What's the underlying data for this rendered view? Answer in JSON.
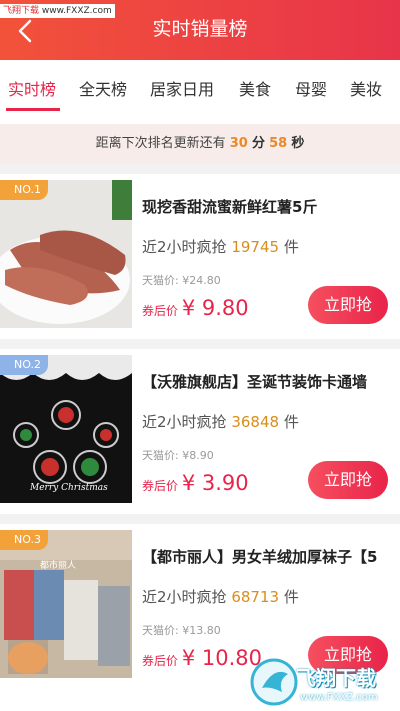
{
  "watermark_top": {
    "brand": "飞翔下载",
    "url": "www.FXXZ.com"
  },
  "header": {
    "title": "实时销量榜",
    "back_icon": "chevron-left-icon"
  },
  "tabs": [
    {
      "label": "实时榜",
      "active": true
    },
    {
      "label": "全天榜",
      "active": false
    },
    {
      "label": "居家日用",
      "active": false
    },
    {
      "label": "美食",
      "active": false
    },
    {
      "label": "母婴",
      "active": false
    },
    {
      "label": "美妆",
      "active": false
    }
  ],
  "countdown": {
    "prefix": "距离下次排名更新还有",
    "minutes": "30",
    "min_unit": "分",
    "seconds": "58",
    "sec_unit": "秒"
  },
  "items": [
    {
      "rank": "NO.1",
      "title": "现挖香甜流蜜新鲜红薯5斤",
      "sales_prefix": "近2小时疯抢",
      "sales_count": "19745",
      "sales_unit": "件",
      "tmall_price": "天猫价: ¥24.80",
      "after_label": "券后价",
      "price": "¥ 9.80",
      "button": "立即抢"
    },
    {
      "rank": "NO.2",
      "title": "【沃雅旗舰店】圣诞节装饰卡通墙",
      "sales_prefix": "近2小时疯抢",
      "sales_count": "36848",
      "sales_unit": "件",
      "tmall_price": "天猫价: ¥8.90",
      "after_label": "券后价",
      "price": "¥ 3.90",
      "button": "立即抢",
      "image_text": "Merry Christmas"
    },
    {
      "rank": "NO.3",
      "title": "【都市丽人】男女羊绒加厚袜子【5",
      "sales_prefix": "近2小时疯抢",
      "sales_count": "68713",
      "sales_unit": "件",
      "tmall_price": "天猫价: ¥13.80",
      "after_label": "券后价",
      "price": "¥ 10.80",
      "button": "立即抢",
      "image_text": "都市丽人"
    }
  ],
  "watermark_bottom": {
    "text": "飞翔下载",
    "url": "www.FXXZ.com"
  },
  "colors": {
    "header": "#ee4040",
    "accent": "#e8244a",
    "count": "#d98d1c"
  }
}
